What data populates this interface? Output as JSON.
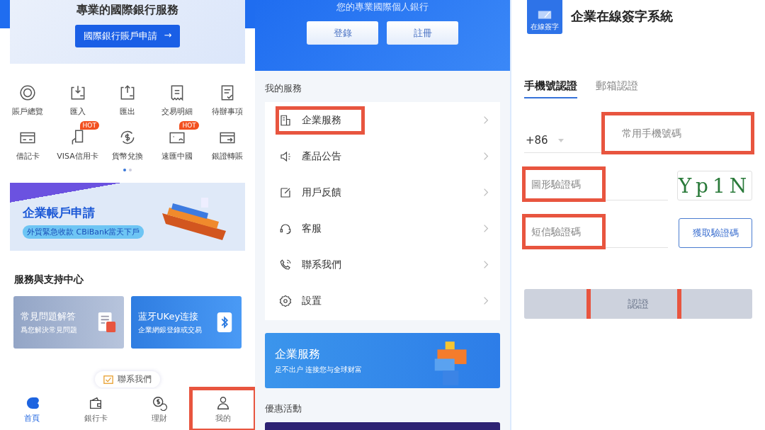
{
  "home": {
    "hero": {
      "title": "專業的國際銀行服務",
      "button": "國際銀行賬戶申請",
      "arrow": "→"
    },
    "shortcuts": [
      {
        "label": "賬戶總覽"
      },
      {
        "label": "匯入"
      },
      {
        "label": "匯出"
      },
      {
        "label": "交易明細"
      },
      {
        "label": "待辦事項"
      },
      {
        "label": "借記卡"
      },
      {
        "label": "VISA信用卡",
        "badge": "HOT"
      },
      {
        "label": "貨幣兌換"
      },
      {
        "label": "速匯中國",
        "badge": "HOT"
      },
      {
        "label": "銀證轉賬"
      }
    ],
    "pager": [
      {
        "selected": true
      },
      {
        "selected": false
      }
    ],
    "banner": {
      "title": "企業帳戶申請",
      "subtitle": "外貿緊急收款 CBiBank當天下戶"
    },
    "support": {
      "title": "服務與支持中心",
      "cards": [
        {
          "kind": "faq",
          "title": "常見問題解答",
          "subtitle": "爲您解決常見問題"
        },
        {
          "kind": "ukey",
          "title": "蓝牙UKey连接",
          "subtitle": "企業網銀登錄或交易"
        }
      ]
    },
    "floating_button": "聯系我們",
    "tab_bar": [
      {
        "label": "首頁",
        "selected": true,
        "highlighted": false
      },
      {
        "label": "銀行卡",
        "selected": false,
        "highlighted": false
      },
      {
        "label": "理財",
        "selected": false,
        "highlighted": false
      },
      {
        "label": "我的",
        "selected": false,
        "highlighted": true
      }
    ]
  },
  "me": {
    "header": {
      "subtitle": "您的專業國際個人銀行",
      "buttons": [
        "登錄",
        "註冊"
      ]
    },
    "section_title": "我的服務",
    "menu": [
      {
        "label": "企業服務",
        "highlighted": true
      },
      {
        "label": "產品公告",
        "highlighted": false
      },
      {
        "label": "用戶反饋",
        "highlighted": false
      },
      {
        "label": "客服",
        "highlighted": false
      },
      {
        "label": "聯系我們",
        "highlighted": false
      },
      {
        "label": "設置",
        "highlighted": false
      }
    ],
    "banner": {
      "title": "企業服務",
      "subtitle": "足不出户 连接您与全球财富"
    },
    "promo_title": "優惠活動"
  },
  "signing": {
    "logo_text": "在線簽字",
    "title": "企業在線簽字系統",
    "tabs": [
      {
        "label": "手機號認證",
        "selected": true
      },
      {
        "label": "郵箱認證",
        "selected": false
      }
    ],
    "country_code": "+86",
    "phone": {
      "placeholder": "常用手機號碼",
      "highlighted": true
    },
    "captcha": {
      "placeholder": "圖形驗證碼",
      "highlighted": true,
      "image_text": "Yp1N"
    },
    "sms": {
      "placeholder": "短信驗證碼",
      "highlighted": true,
      "button": "獲取驗證碼"
    },
    "submit": {
      "label": "認證",
      "disabled": true,
      "highlighted": true
    }
  }
}
